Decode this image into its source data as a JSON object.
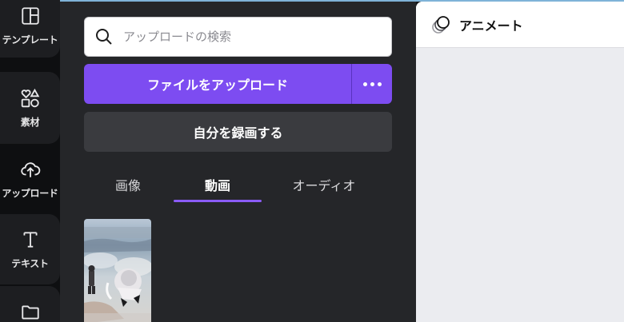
{
  "rail": {
    "template_label": "テンプレート",
    "elements_label": "素材",
    "uploads_label": "アップロード",
    "text_label": "テキスト"
  },
  "panel": {
    "search_placeholder": "アップロードの検索",
    "upload_button": "ファイルをアップロード",
    "record_button": "自分を録画する",
    "tabs": [
      {
        "label": "画像",
        "active": false
      },
      {
        "label": "動画",
        "active": true
      },
      {
        "label": "オーディオ",
        "active": false
      }
    ]
  },
  "canvas": {
    "animate_label": "アニメート"
  },
  "colors": {
    "accent": "#7d4cf1",
    "panel_bg": "#252629",
    "rail_bg": "#0e0f11"
  }
}
